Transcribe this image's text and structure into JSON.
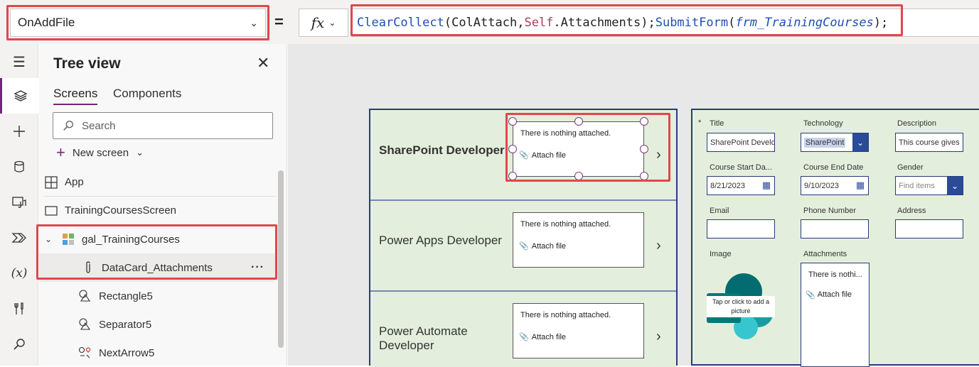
{
  "formula_bar": {
    "property": "OnAddFile",
    "equals": "=",
    "fx_label": "fx",
    "tokens": {
      "fn1": "ClearCollect",
      "p1": "(",
      "arg1": "ColAttach",
      "c1": ",",
      "kw": "Self",
      "arg2": ".Attachments",
      "p2": ");",
      "fn2": "SubmitForm",
      "p3": "(",
      "arg3": "frm_TrainingCourses",
      "p4": ");"
    }
  },
  "rail": {
    "icons": [
      "hamburger-icon",
      "layers-icon",
      "plus-icon",
      "database-icon",
      "media-icon",
      "power-automate-icon",
      "variables-icon",
      "tools-icon",
      "search-icon"
    ],
    "variables_label": "(x)"
  },
  "tree_view": {
    "title": "Tree view",
    "tabs": [
      "Screens",
      "Components"
    ],
    "search_placeholder": "Search",
    "new_screen": "New screen",
    "items": [
      "App",
      "TrainingCoursesScreen",
      "gal_TrainingCourses",
      "DataCard_Attachments",
      "Rectangle5",
      "Separator5",
      "NextArrow5"
    ],
    "more": "···"
  },
  "gallery": {
    "rows": [
      {
        "title": "SharePoint Developer",
        "attach_text": "There is nothing attached.",
        "attach_file": "Attach file"
      },
      {
        "title": "Power Apps Developer",
        "attach_text": "There is nothing attached.",
        "attach_file": "Attach file"
      },
      {
        "title": "Power Automate Developer",
        "attach_text": "There is nothing attached.",
        "attach_file": "Attach file"
      }
    ]
  },
  "form": {
    "required_star": "*",
    "fields": {
      "title_label": "Title",
      "title_value": "SharePoint Develo",
      "technology_label": "Technology",
      "technology_value": "SharePoint",
      "description_label": "Description",
      "description_value": "This course gives",
      "start_label": "Course Start Da...",
      "start_value": "8/21/2023",
      "end_label": "Course End Date",
      "end_value": "9/10/2023",
      "gender_label": "Gender",
      "gender_placeholder": "Find items",
      "email_label": "Email",
      "phone_label": "Phone Number",
      "address_label": "Address",
      "image_label": "Image",
      "image_hint": "Tap or click to add a picture",
      "attachments_label": "Attachments",
      "attach_text": "There is nothi...",
      "attach_file": "Attach file"
    }
  },
  "colors": {
    "accent": "#742774",
    "highlight": "#e0474c",
    "form_bg": "#e3efdc",
    "border_navy": "#2a3a7a"
  }
}
